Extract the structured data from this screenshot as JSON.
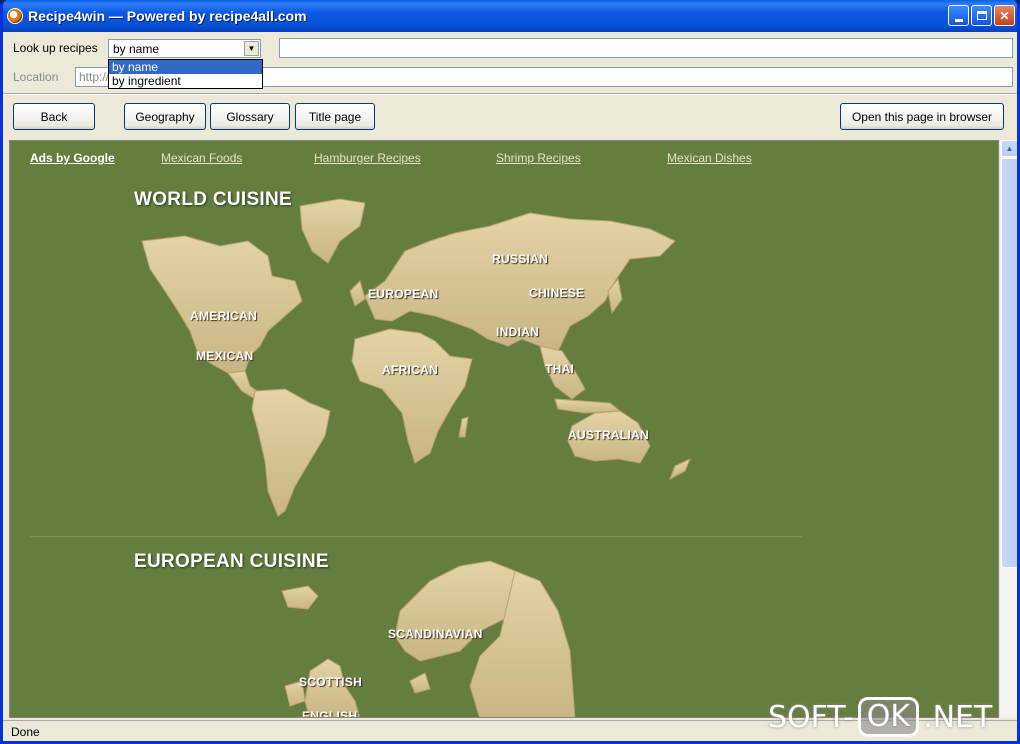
{
  "window": {
    "title": "Recipe4win — Powered by recipe4all.com"
  },
  "lookup": {
    "label": "Look up recipes",
    "selected": "by name",
    "options": [
      "by name",
      "by ingredient"
    ],
    "search_value": ""
  },
  "location": {
    "label": "Location",
    "value": "http://"
  },
  "toolbar": {
    "back": "Back",
    "geography": "Geography",
    "glossary": "Glossary",
    "title_page": "Title page",
    "open_browser": "Open this page in browser"
  },
  "ads": {
    "label": "Ads by Google",
    "links": [
      "Mexican Foods",
      "Hamburger Recipes",
      "Shrimp Recipes",
      "Mexican Dishes"
    ]
  },
  "world": {
    "title": "WORLD CUISINE",
    "regions": [
      "AMERICAN",
      "MEXICAN",
      "EUROPEAN",
      "RUSSIAN",
      "CHINESE",
      "INDIAN",
      "THAI",
      "AFRICAN",
      "AUSTRALIAN"
    ]
  },
  "europe": {
    "title": "EUROPEAN CUISINE",
    "regions": [
      "SCANDINAVIAN",
      "SCOTTISH",
      "ENGLISH"
    ]
  },
  "status": {
    "text": "Done"
  },
  "watermark": {
    "left": "SOFT-",
    "mid": "OK",
    "right": ".NET"
  },
  "colors": {
    "page_bg": "#657e40",
    "land": "#d9c89a",
    "titlebar": "#0a5ee8"
  }
}
